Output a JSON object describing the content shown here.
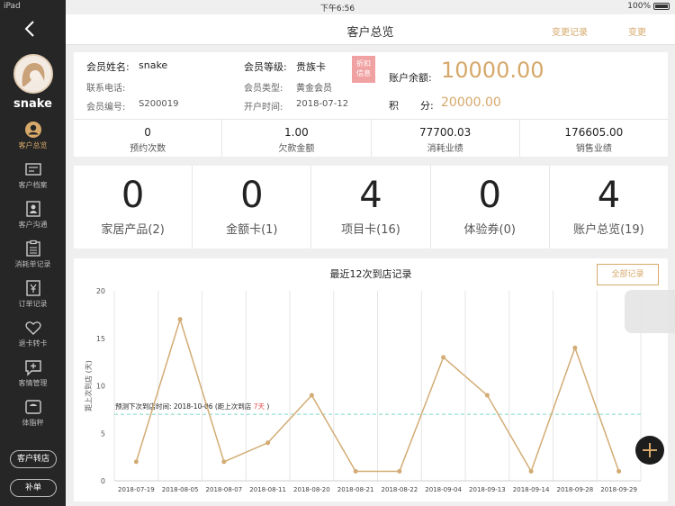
{
  "status": {
    "device": "iPad",
    "time": "下午6:56",
    "battery": "100%"
  },
  "header": {
    "title": "客户总览",
    "change_log": "变更记录",
    "change": "变更"
  },
  "sidebar": {
    "username": "snake",
    "items": [
      {
        "label": "客户总览",
        "icon": "user-icon"
      },
      {
        "label": "客户档案",
        "icon": "id-card-icon"
      },
      {
        "label": "客户沟通",
        "icon": "contact-icon"
      },
      {
        "label": "消耗单记录",
        "icon": "list-icon"
      },
      {
        "label": "订单记录",
        "icon": "yen-doc-icon"
      },
      {
        "label": "退卡转卡",
        "icon": "heart-tag-icon"
      },
      {
        "label": "客情管理",
        "icon": "chat-plus-icon"
      },
      {
        "label": "体脂秤",
        "icon": "scale-icon"
      }
    ],
    "transfer_btn": "客户转店",
    "supplement_btn": "补单"
  },
  "info": {
    "name_label": "会员姓名:",
    "name": "snake",
    "level_label": "会员等级:",
    "level": "贵族卡",
    "badge_line1": "折扣",
    "badge_line2": "信息",
    "phone_label": "联系电话:",
    "phone": "",
    "type_label": "会员类型:",
    "type": "黄金会员",
    "no_label": "会员编号:",
    "no": "S200019",
    "open_label": "开户时间:",
    "open_date": "2018-07-12",
    "balance_label": "账户余额:",
    "balance": "10000.00",
    "points_label1": "积",
    "points_label2": "分:",
    "points": "20000.00"
  },
  "stats": [
    {
      "value": "0",
      "label": "预约次数"
    },
    {
      "value": "1.00",
      "label": "欠款金额"
    },
    {
      "value": "77700.03",
      "label": "消耗业绩"
    },
    {
      "value": "176605.00",
      "label": "销售业绩"
    }
  ],
  "cards": [
    {
      "value": "0",
      "label": "家居产品(2)"
    },
    {
      "value": "0",
      "label": "金额卡(1)"
    },
    {
      "value": "4",
      "label": "项目卡(16)"
    },
    {
      "value": "0",
      "label": "体验券(0)"
    },
    {
      "value": "4",
      "label": "账户总览(19)"
    }
  ],
  "chart": {
    "all_records": "全部记录"
  },
  "chart_data": {
    "type": "line",
    "title": "最近12次到店记录",
    "ylabel": "距上次到店 (天)",
    "xlabel": "",
    "ylim": [
      0,
      20
    ],
    "yticks": [
      0,
      5,
      10,
      15,
      20
    ],
    "categories": [
      "2018-07-19",
      "2018-08-05",
      "2018-08-07",
      "2018-08-11",
      "2018-08-20",
      "2018-08-21",
      "2018-08-22",
      "2018-09-04",
      "2018-09-13",
      "2018-09-14",
      "2018-09-28",
      "2018-09-29"
    ],
    "values": [
      2,
      17,
      2,
      4,
      9,
      1,
      1,
      13,
      9,
      1,
      14,
      1
    ],
    "prediction": {
      "text_prefix": "预测下次到店时间: 2018-10-06 (距上次到店 ",
      "days": "7天",
      "text_suffix": " )",
      "value": 7
    },
    "colors": {
      "line": "#d2ac74",
      "prediction": "#7fd6c6",
      "days": "#e24c4c"
    },
    "grid": true
  }
}
